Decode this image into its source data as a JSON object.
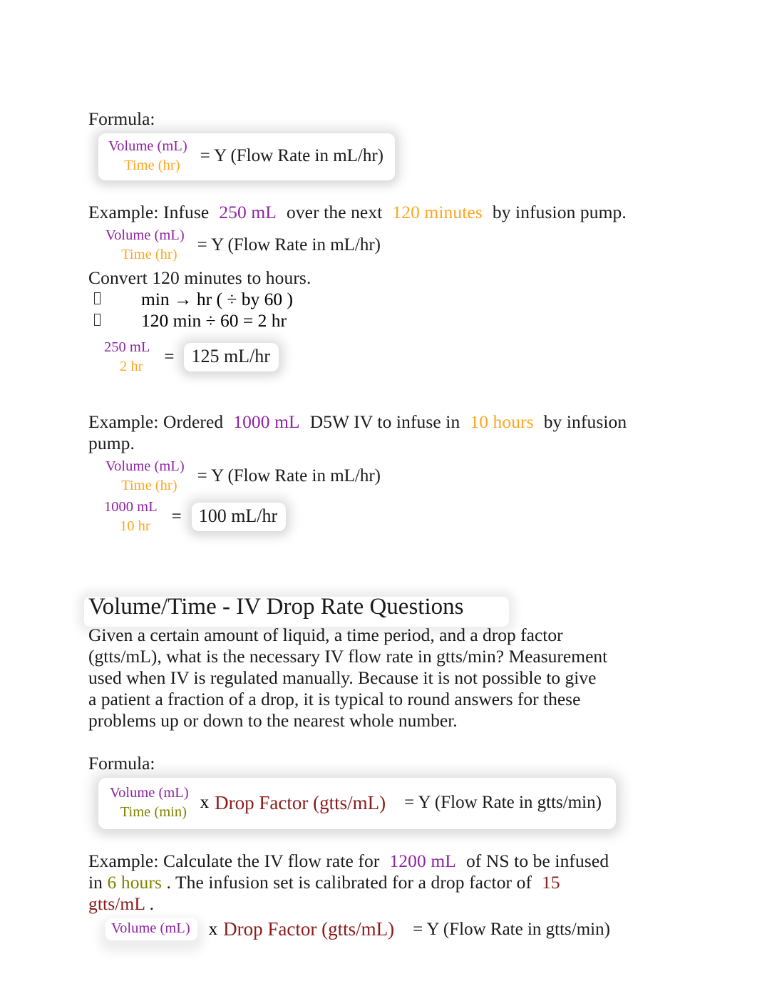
{
  "document": {
    "type": "nursing-dosage-calculation-handout",
    "colors": {
      "volume_purple": "#8e24a2",
      "time_orange": "#ffa520",
      "time_olive": "#808000",
      "drop_factor_dark_red": "#8b1a1a",
      "body_text": "#1a1a1a",
      "page_background": "#ffffff"
    }
  },
  "section_flow_rate": {
    "formula_label": "Formula:",
    "formula": {
      "numerator": "Volume (mL)",
      "denominator": "Time (hr)",
      "equals_text": "= Y (Flow Rate in mL/hr)"
    }
  },
  "example_1": {
    "prefix": "Example: Infuse",
    "volume": "250 mL",
    "middle": "over the next",
    "time": "120 minutes",
    "suffix": "by infusion pump.",
    "formula": {
      "numerator": "Volume (mL)",
      "denominator": "Time (hr)",
      "equals_text": "= Y (Flow Rate in mL/hr)"
    },
    "convert_line": "Convert 120 minutes to hours.",
    "bullets": [
      "min  →  hr ( ÷ by 60 )",
      "120 min ÷ 60 = 2 hr"
    ],
    "calculation": {
      "numerator": "250 mL",
      "denominator": "2 hr",
      "equals_sign": "=",
      "answer": "125 mL/hr"
    }
  },
  "example_2": {
    "prefix": "Example: Ordered",
    "volume": "1000 mL",
    "middle": "D5W IV to infuse in",
    "time": "10 hours",
    "suffix": "by infusion",
    "suffix_line2": "pump.",
    "formula": {
      "numerator": "Volume (mL)",
      "denominator": "Time (hr)",
      "equals_text": "= Y (Flow Rate in mL/hr)"
    },
    "calculation": {
      "numerator": "1000 mL",
      "denominator": "10 hr",
      "equals_sign": "=",
      "answer": "100 mL/hr"
    }
  },
  "section_drop_rate": {
    "heading": "Volume/Time - IV Drop Rate Questions",
    "body_lines": [
      "Given a certain amount of liquid, a time period, and a drop factor",
      "(gtts/mL), what is the necessary IV flow rate in gtts/min? Measurement",
      "used when IV is regulated manually. Because it is not possible to give",
      "a patient a fraction of a drop, it is typical to round answers for these",
      "problems up or down to the nearest whole number."
    ],
    "formula_label": "Formula:",
    "formula": {
      "numerator": "Volume (mL)",
      "denominator": "Time (min)",
      "multiply_sign": "x",
      "drop_factor": "Drop Factor (gtts/mL)",
      "equals_text": "= Y (Flow Rate in gtts/min)"
    }
  },
  "example_3": {
    "prefix": "Example: Calculate the IV flow rate for",
    "volume": "1200 mL",
    "middle": "of NS to be infused",
    "line2_prefix": "in",
    "time": "6 hours",
    "line2_middle": ". The infusion set is calibrated for a drop factor of",
    "drop_factor_value": "15",
    "drop_factor_unit": "gtts/mL",
    "line3_suffix": ".",
    "formula": {
      "numerator": "Volume (mL)",
      "multiply_sign": "x",
      "drop_factor": "Drop Factor (gtts/mL)",
      "equals_text": "= Y (Flow Rate in gtts/min)"
    }
  }
}
